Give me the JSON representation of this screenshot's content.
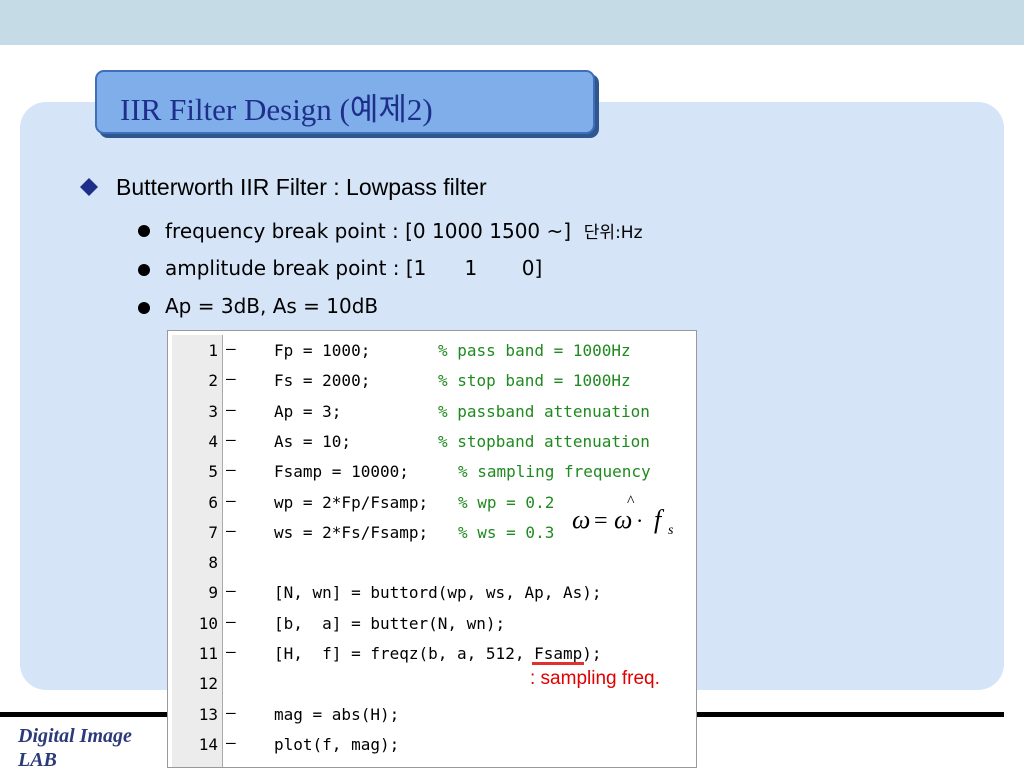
{
  "title": "IIR Filter Design (예제2)",
  "heading": "Butterworth IIR Filter : Lowpass filter",
  "bullets": [
    {
      "text": "frequency break point : [0 1000 1500 ~]",
      "suffix": "단위:Hz"
    },
    {
      "text": "amplitude break point : [1      1       0]",
      "suffix": ""
    },
    {
      "text": "Ap = 3dB, As = 10dB",
      "suffix": ""
    }
  ],
  "footer": "Digital Image LAB",
  "code_lines": [
    {
      "num": "1",
      "dash": "–",
      "code": "Fp = 1000;",
      "comment": "% pass band = 1000Hz"
    },
    {
      "num": "2",
      "dash": "–",
      "code": "Fs = 2000;",
      "comment": "% stop band = 1000Hz"
    },
    {
      "num": "3",
      "dash": "–",
      "code": "Ap = 3;",
      "comment": "% passband attenuation"
    },
    {
      "num": "4",
      "dash": "–",
      "code": "As = 10;",
      "comment": "% stopband attenuation"
    },
    {
      "num": "5",
      "dash": "–",
      "code": "Fsamp = 10000;",
      "comment": "% sampling frequency"
    },
    {
      "num": "6",
      "dash": "–",
      "code": "wp = 2*Fp/Fsamp;",
      "comment": "% wp = 0.2"
    },
    {
      "num": "7",
      "dash": "–",
      "code": "ws = 2*Fs/Fsamp;",
      "comment": "% ws = 0.3"
    },
    {
      "num": "8",
      "dash": "",
      "code": "",
      "comment": ""
    },
    {
      "num": "9",
      "dash": "–",
      "code": "[N, wn] = buttord(wp, ws, Ap, As);",
      "comment": ""
    },
    {
      "num": "10",
      "dash": "–",
      "code": "[b,  a] = butter(N, wn);",
      "comment": ""
    },
    {
      "num": "11",
      "dash": "–",
      "code": "[H,  f] = freqz(b, a, 512, Fsamp);",
      "comment": ""
    },
    {
      "num": "12",
      "dash": "",
      "code": "",
      "comment": ""
    },
    {
      "num": "13",
      "dash": "–",
      "code": "mag = abs(H);",
      "comment": ""
    },
    {
      "num": "14",
      "dash": "–",
      "code": "plot(f, mag);",
      "comment": ""
    }
  ],
  "note": ": sampling freq.",
  "formula": {
    "lhs": "ω",
    "eq": "=",
    "rhs": "ω",
    "dot": "·",
    "f": "f",
    "sub": "s",
    "hat": "^"
  }
}
